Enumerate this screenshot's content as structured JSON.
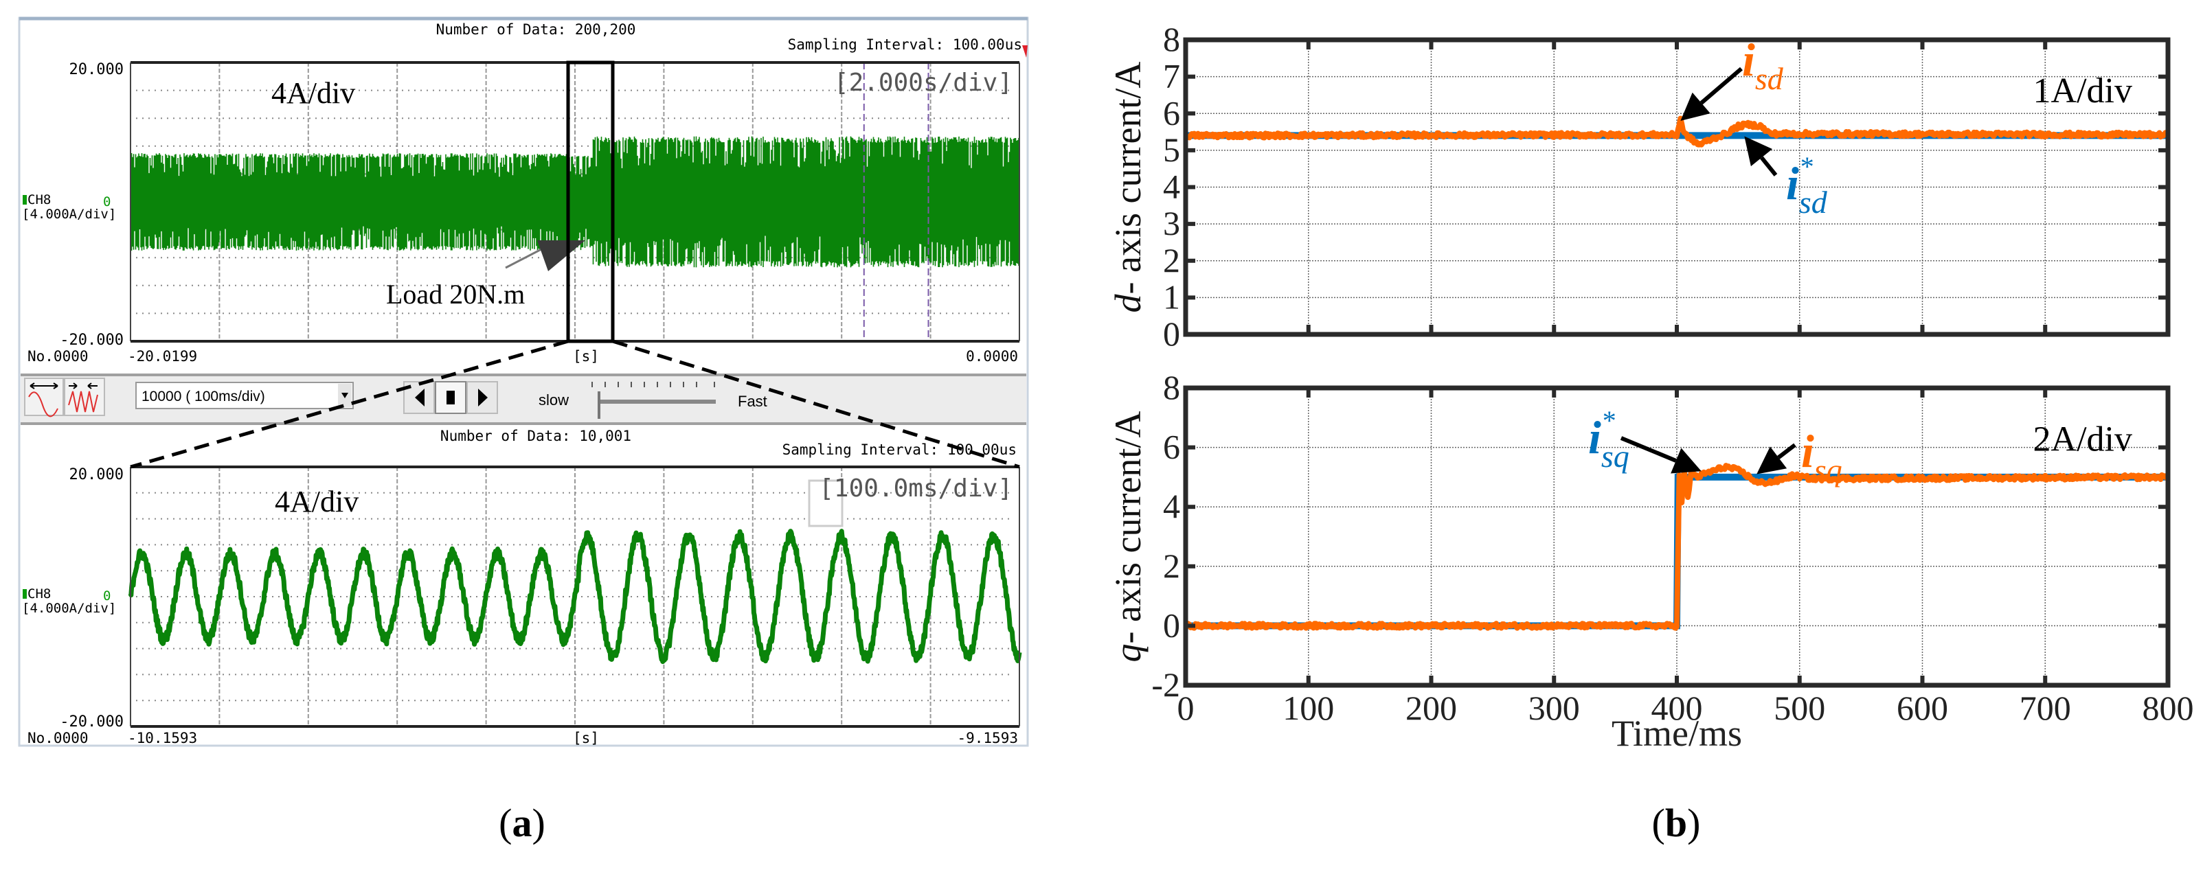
{
  "panel_a": {
    "caption_open": "(",
    "caption_letter": "a",
    "caption_close": ")",
    "scope_top": {
      "number_of_data": "Number of Data: 200,200",
      "sampling_interval": "Sampling Interval:  100.00us",
      "ymax": "20.000",
      "ymin": "-20.000",
      "channel": "CH8",
      "channel_scale": "[4.000A/div]",
      "zero_marker": "0",
      "annotation": "4A/div",
      "timebase": "[2.000s/div]",
      "record_no": "No.0000",
      "x_start": "-20.0199",
      "x_unit": "[s]",
      "x_end": "0.0000",
      "load_label": "Load 20N.m",
      "waveform": {
        "t_start": -20.0199,
        "t_end": 0.0,
        "step_time": -9.6,
        "amp_before": 7.0,
        "amp_after": 9.4,
        "y_range": [
          -20,
          20
        ]
      },
      "cursor_times": [
        -3.5,
        -2.05
      ]
    },
    "toolbar": {
      "record_length": "10000  ( 100ms/div)",
      "slow_label": "slow",
      "fast_label": "Fast"
    },
    "scope_bottom": {
      "number_of_data": "Number of Data: 10,001",
      "sampling_interval": "Sampling Interval:  100.00us",
      "ymax": "20.000",
      "ymin": "-20.000",
      "channel": "CH8",
      "channel_scale": "[4.000A/div]",
      "zero_marker": "0",
      "annotation": "4A/div",
      "timebase": "[100.0ms/div]",
      "record_no": "No.0000",
      "x_start": "-10.1593",
      "x_unit": "[s]",
      "x_end": "-9.1593",
      "waveform": {
        "t_start": -10.1593,
        "t_end": -9.1593,
        "step_time": -9.655,
        "amp_before": 6.6,
        "freq_before_hz": 20,
        "amp_after": 9.3,
        "freq_after_hz": 17.5,
        "y_range": [
          -20,
          20
        ]
      }
    },
    "colors": {
      "trace": "#0a840a",
      "zoom_box": "#000000",
      "cursor": "#7a5aa8"
    }
  },
  "panel_b": {
    "caption_open": "(",
    "caption_letter": "b",
    "caption_close": ")"
  },
  "chart_data": [
    {
      "type": "line",
      "title": "",
      "ylabel_italic": "d",
      "ylabel_rest": "- axis current/A",
      "xlabel": "",
      "xlim": [
        0,
        800
      ],
      "ylim": [
        0,
        8
      ],
      "xticks": [
        0,
        100,
        200,
        300,
        400,
        500,
        600,
        700,
        800
      ],
      "yticks": [
        "0",
        "1",
        "2",
        "3",
        "4",
        "5",
        "6",
        "7",
        "8"
      ],
      "ytick_values": [
        0,
        1,
        2,
        3,
        4,
        5,
        6,
        7,
        8
      ],
      "grid": true,
      "scale_note": "1A/div",
      "annotations": [
        {
          "main": "i",
          "sub": "sd",
          "sup": "",
          "color": "#ff6a00",
          "target": [
            403,
            5.8
          ]
        },
        {
          "main": "i",
          "sub": "sd",
          "sup": "*",
          "color": "#0072bd",
          "target": [
            455,
            5.38
          ]
        }
      ],
      "series": [
        {
          "name": "i*sd",
          "color": "#0072bd",
          "points": [
            [
              0,
              5.4
            ],
            [
              800,
              5.4
            ]
          ]
        },
        {
          "name": "isd",
          "color": "#ff6a00",
          "points": [
            [
              0,
              5.4
            ],
            [
              400,
              5.42
            ],
            [
              403,
              5.85
            ],
            [
              406,
              5.45
            ],
            [
              410,
              5.35
            ],
            [
              418,
              5.15
            ],
            [
              428,
              5.3
            ],
            [
              440,
              5.45
            ],
            [
              450,
              5.65
            ],
            [
              458,
              5.7
            ],
            [
              468,
              5.66
            ],
            [
              476,
              5.45
            ],
            [
              800,
              5.42
            ]
          ]
        }
      ]
    },
    {
      "type": "line",
      "title": "",
      "ylabel_italic": "q",
      "ylabel_rest": "- axis current/A",
      "xlabel": "Time/ms",
      "xlim": [
        0,
        800
      ],
      "ylim": [
        -2,
        8
      ],
      "xticks": [
        "0",
        "100",
        "200",
        "300",
        "400",
        "500",
        "600",
        "700",
        "800"
      ],
      "xtick_values": [
        0,
        100,
        200,
        300,
        400,
        500,
        600,
        700,
        800
      ],
      "yticks": [
        "-2",
        "0",
        "2",
        "4",
        "6",
        "8"
      ],
      "ytick_values": [
        -2,
        0,
        2,
        4,
        6,
        8
      ],
      "grid": true,
      "scale_note": "2A/div",
      "annotations": [
        {
          "main": "i",
          "sub": "sq",
          "sup": "*",
          "color": "#0072bd",
          "target": [
            420,
            5.2
          ]
        },
        {
          "main": "i",
          "sub": "sq",
          "sup": "",
          "color": "#ff6a00",
          "target": [
            465,
            5.1
          ]
        }
      ],
      "series": [
        {
          "name": "i*sq",
          "color": "#0072bd",
          "points": [
            [
              0,
              0
            ],
            [
              400,
              0
            ],
            [
              401,
              5
            ],
            [
              800,
              5
            ]
          ]
        },
        {
          "name": "isq",
          "color": "#ff6a00",
          "points": [
            [
              0,
              0
            ],
            [
              400,
              0
            ],
            [
              402,
              5.1
            ],
            [
              404,
              4.1
            ],
            [
              406,
              5.2
            ],
            [
              409,
              4.3
            ],
            [
              412,
              5.25
            ],
            [
              416,
              5.0
            ],
            [
              425,
              5.15
            ],
            [
              440,
              5.35
            ],
            [
              452,
              5.2
            ],
            [
              466,
              4.8
            ],
            [
              480,
              4.85
            ],
            [
              495,
              5.05
            ],
            [
              510,
              4.95
            ],
            [
              800,
              5.0
            ]
          ]
        }
      ]
    }
  ]
}
